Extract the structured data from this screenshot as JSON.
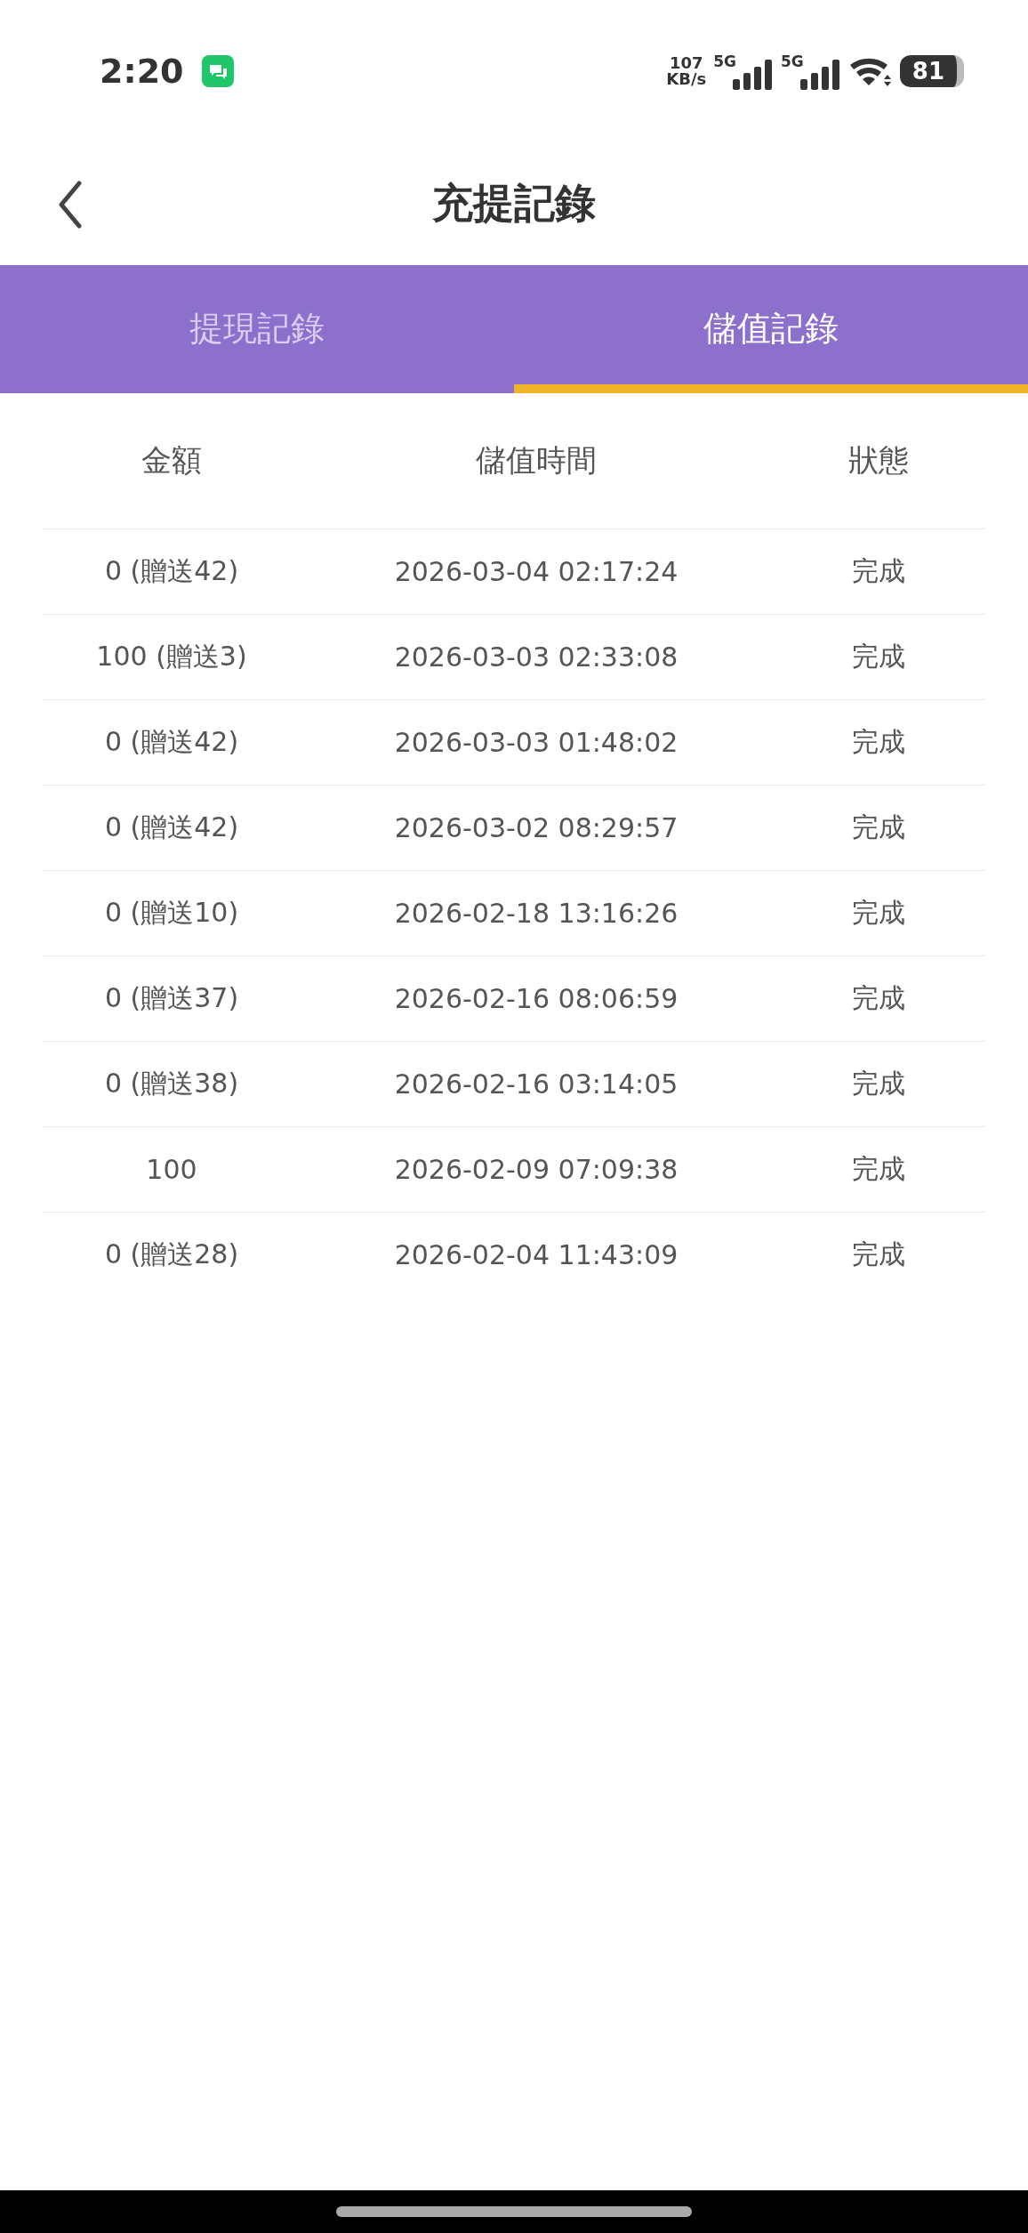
{
  "status_bar": {
    "time": "2:20",
    "speed_value": "107",
    "speed_unit": "KB/s",
    "network_labels": [
      "5G",
      "5G"
    ],
    "battery": "81"
  },
  "header": {
    "title": "充提記錄"
  },
  "tabs": [
    {
      "label": "提現記錄",
      "selected": false
    },
    {
      "label": "儲值記錄",
      "selected": true
    }
  ],
  "table": {
    "columns": [
      "金額",
      "儲值時間",
      "狀態"
    ],
    "rows": [
      [
        "0 (贈送42)",
        "2026-03-04 02:17:24",
        "完成"
      ],
      [
        "100 (贈送3)",
        "2026-03-03 02:33:08",
        "完成"
      ],
      [
        "0 (贈送42)",
        "2026-03-03 01:48:02",
        "完成"
      ],
      [
        "0 (贈送42)",
        "2026-03-02 08:29:57",
        "完成"
      ],
      [
        "0 (贈送10)",
        "2026-02-18 13:16:26",
        "完成"
      ],
      [
        "0 (贈送37)",
        "2026-02-16 08:06:59",
        "完成"
      ],
      [
        "0 (贈送38)",
        "2026-02-16 03:14:05",
        "完成"
      ],
      [
        "100",
        "2026-02-09 07:09:38",
        "完成"
      ],
      [
        "0 (贈送28)",
        "2026-02-04 11:43:09",
        "完成"
      ]
    ]
  }
}
